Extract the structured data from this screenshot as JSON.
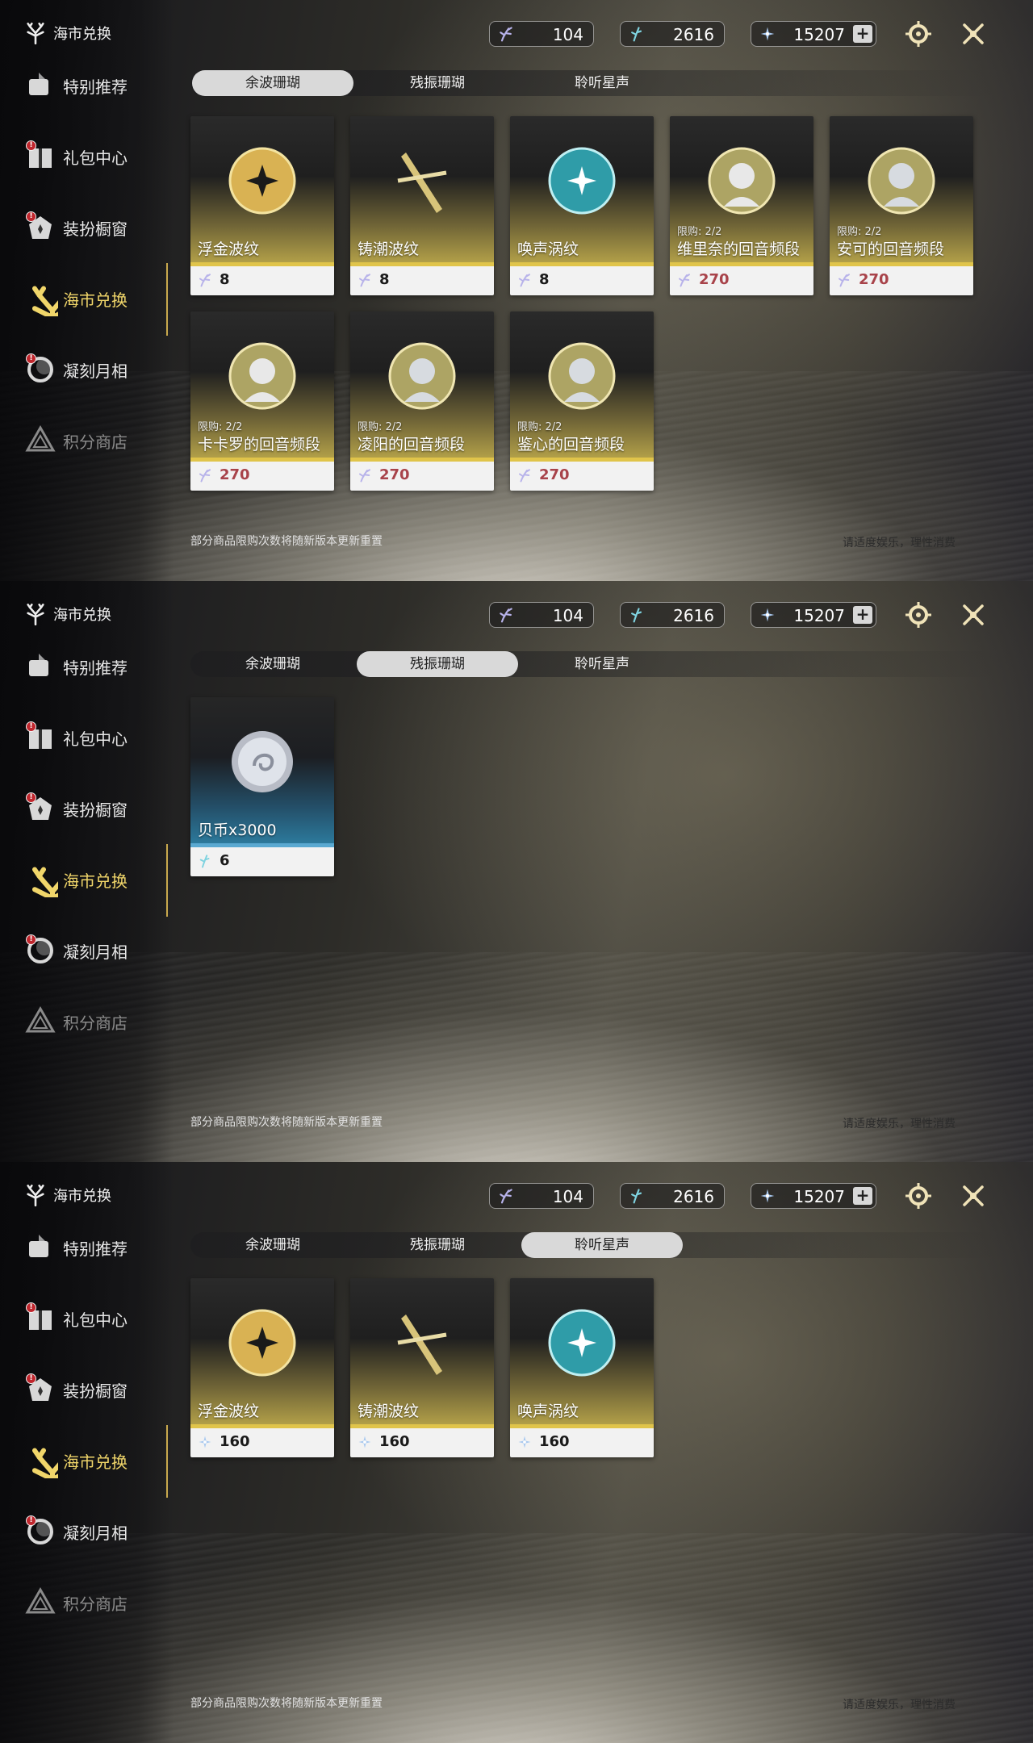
{
  "header": {
    "title": "海市兑换",
    "currencies": [
      {
        "icon": "lavender-coral-icon",
        "value": "104"
      },
      {
        "icon": "teal-coral-icon",
        "value": "2616"
      },
      {
        "icon": "star-shard-icon",
        "value": "15207"
      }
    ],
    "plus": "+"
  },
  "sidebar": {
    "items": [
      {
        "label": "特别推荐",
        "icon": "special-offer-icon"
      },
      {
        "label": "礼包中心",
        "icon": "gift-icon",
        "badge": "!"
      },
      {
        "label": "装扮橱窗",
        "icon": "outfit-icon",
        "badge": "!"
      },
      {
        "label": "海市兑换",
        "icon": "coral-icon"
      },
      {
        "label": "凝刻月相",
        "icon": "moon-icon",
        "badge": "!"
      },
      {
        "label": "积分商店",
        "icon": "points-icon"
      }
    ]
  },
  "tabs": [
    "余波珊瑚",
    "残振珊瑚",
    "聆听星声"
  ],
  "panels": [
    {
      "active_tab": 0,
      "cards": [
        {
          "name": "浮金波纹",
          "price": "8"
        },
        {
          "name": "铸潮波纹",
          "price": "8"
        },
        {
          "name": "唤声涡纹",
          "price": "8"
        },
        {
          "name": "维里奈的回音频段",
          "price": "270",
          "limit": "限购: 2/2"
        },
        {
          "name": "安可的回音频段",
          "price": "270",
          "limit": "限购: 2/2"
        },
        {
          "name": "卡卡罗的回音频段",
          "price": "270",
          "limit": "限购: 2/2"
        },
        {
          "name": "凌阳的回音频段",
          "price": "270",
          "limit": "限购: 2/2"
        },
        {
          "name": "鉴心的回音频段",
          "price": "270",
          "limit": "限购: 2/2"
        }
      ]
    },
    {
      "active_tab": 1,
      "cards": [
        {
          "name": "贝币x3000",
          "price": "6"
        }
      ]
    },
    {
      "active_tab": 2,
      "cards": [
        {
          "name": "浮金波纹",
          "price": "160"
        },
        {
          "name": "铸潮波纹",
          "price": "160"
        },
        {
          "name": "唤声涡纹",
          "price": "160"
        }
      ]
    }
  ],
  "footer": {
    "note": "部分商品限购次数将随新版本更新重置",
    "advice": "请适度娱乐，理性消费"
  },
  "colors": {
    "accent": "#f1d66a",
    "gold_band": "#e0c44a",
    "blue_band": "#5aa9d1",
    "limit_price": "#a8434a"
  }
}
